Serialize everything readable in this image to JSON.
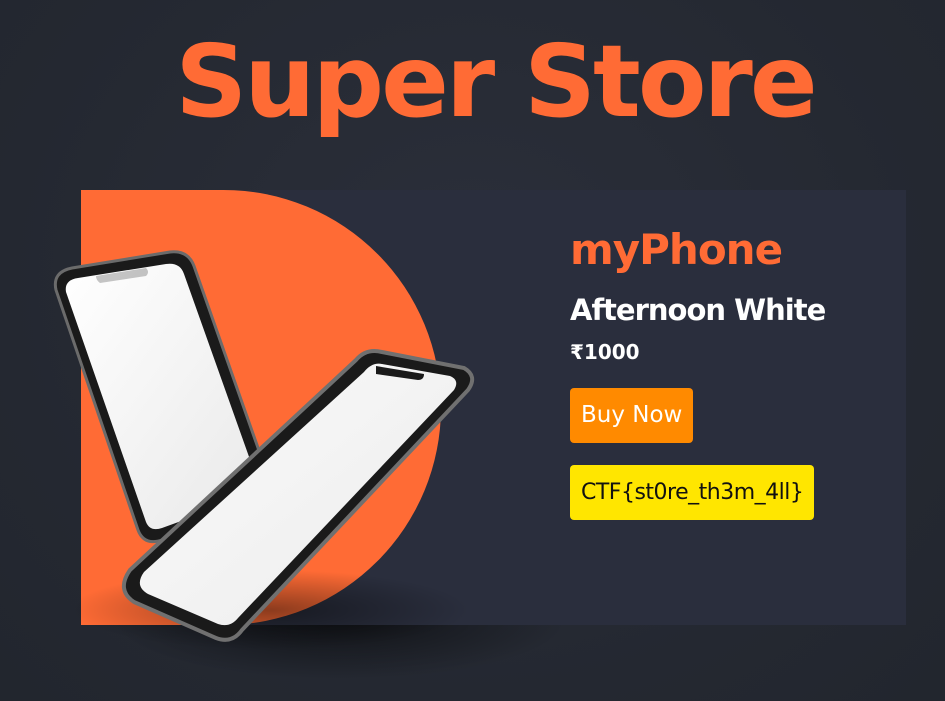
{
  "store": {
    "title": "Super Store"
  },
  "product": {
    "name": "myPhone",
    "variant": "Afternoon White",
    "price": "₹1000",
    "buy_label": "Buy Now",
    "flag_text": "CTF{st0re_th3m_4ll}"
  },
  "colors": {
    "background": "#262a33",
    "card": "#2a2e3d",
    "accent": "#ff6b35",
    "buy_button": "#ff8a00",
    "flag_box": "#ffe600"
  }
}
